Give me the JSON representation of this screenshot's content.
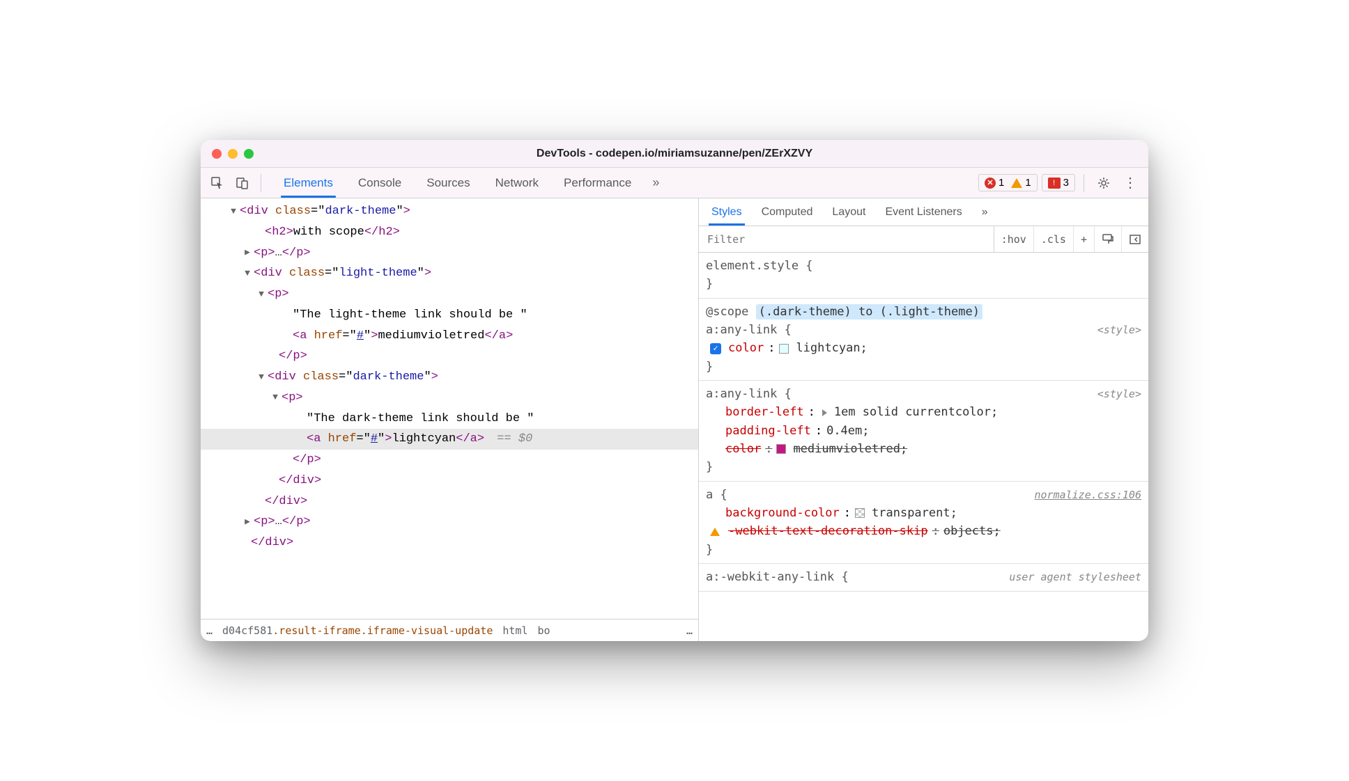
{
  "window": {
    "title": "DevTools - codepen.io/miriamsuzanne/pen/ZErXZVY"
  },
  "toolbar": {
    "tabs": [
      "Elements",
      "Console",
      "Sources",
      "Network",
      "Performance"
    ],
    "active_tab": 0,
    "errors": "1",
    "warnings": "1",
    "issues": "3"
  },
  "dom": {
    "lines": [
      {
        "indent": 40,
        "arrow": "▼",
        "html": "<span class='tag'>&lt;div</span> <span class='attr-name'>class</span>=\"<span class='attr-value'>dark-theme</span>\"<span class='tag'>&gt;</span>"
      },
      {
        "indent": 76,
        "arrow": "",
        "html": "<span class='tag'>&lt;h2&gt;</span><span class='text-content'>with scope</span><span class='tag'>&lt;/h2&gt;</span>"
      },
      {
        "indent": 60,
        "arrow": "▶",
        "html": "<span class='tag'>&lt;p&gt;</span><span class='ellipsis'>…</span><span class='tag'>&lt;/p&gt;</span>"
      },
      {
        "indent": 60,
        "arrow": "▼",
        "html": "<span class='tag'>&lt;div</span> <span class='attr-name'>class</span>=\"<span class='attr-value'>light-theme</span>\"<span class='tag'>&gt;</span>"
      },
      {
        "indent": 80,
        "arrow": "▼",
        "html": "<span class='tag'>&lt;p&gt;</span>"
      },
      {
        "indent": 116,
        "arrow": "",
        "html": "<span class='text-content'>\"The light-theme link should be \"</span>"
      },
      {
        "indent": 116,
        "arrow": "",
        "html": "<span class='tag'>&lt;a</span> <span class='attr-name'>href</span>=\"<span class='href-link'>#</span>\"<span class='tag'>&gt;</span><span class='text-content'>mediumvioletred</span><span class='tag'>&lt;/a&gt;</span>"
      },
      {
        "indent": 96,
        "arrow": "",
        "html": "<span class='tag'>&lt;/p&gt;</span>"
      },
      {
        "indent": 80,
        "arrow": "▼",
        "html": "<span class='tag'>&lt;div</span> <span class='attr-name'>class</span>=\"<span class='attr-value'>dark-theme</span>\"<span class='tag'>&gt;</span>"
      },
      {
        "indent": 100,
        "arrow": "▼",
        "html": "<span class='tag'>&lt;p&gt;</span>"
      },
      {
        "indent": 136,
        "arrow": "",
        "html": "<span class='text-content'>\"The dark-theme link should be \"</span>"
      },
      {
        "indent": 136,
        "arrow": "",
        "selected": true,
        "html": "<span class='tag'>&lt;a</span> <span class='attr-name'>href</span>=\"<span class='href-link'>#</span>\"<span class='tag'>&gt;</span><span class='text-content'>lightcyan</span><span class='tag'>&lt;/a&gt;</span><span class='selector-dollar'> == $0</span>"
      },
      {
        "indent": 116,
        "arrow": "",
        "html": "<span class='tag'>&lt;/p&gt;</span>"
      },
      {
        "indent": 96,
        "arrow": "",
        "html": "<span class='tag'>&lt;/div&gt;</span>"
      },
      {
        "indent": 76,
        "arrow": "",
        "html": "<span class='tag'>&lt;/div&gt;</span>"
      },
      {
        "indent": 60,
        "arrow": "▶",
        "html": "<span class='tag'>&lt;p&gt;</span><span class='ellipsis'>…</span><span class='tag'>&lt;/p&gt;</span>"
      },
      {
        "indent": 56,
        "arrow": "",
        "html": "<span class='tag'>&lt;/div&gt;</span>"
      }
    ]
  },
  "breadcrumb": {
    "prefix": "…",
    "items": [
      {
        "text": "d04cf581",
        "cls": ""
      },
      {
        "text": ".result-iframe.iframe-visual-update",
        "cls": "highlight",
        "inline": true
      },
      {
        "text": "html",
        "cls": ""
      },
      {
        "text": "bo",
        "cls": ""
      }
    ],
    "suffix": "…"
  },
  "styles": {
    "tabs": [
      "Styles",
      "Computed",
      "Layout",
      "Event Listeners"
    ],
    "active_tab": 0,
    "filter_placeholder": "Filter",
    "tools": [
      ":hov",
      ".cls",
      "+"
    ],
    "rules": [
      {
        "selector": "element.style {",
        "source": "",
        "decls": [],
        "close": "}"
      },
      {
        "scope_prefix": "@scope",
        "scope_highlight": "(.dark-theme) to (.light-theme)",
        "selector": "a:any-link {",
        "source": "<style>",
        "decls": [
          {
            "checkbox": true,
            "name": "color",
            "value": "lightcyan",
            "swatch": "#e0ffff"
          }
        ],
        "close": "}"
      },
      {
        "selector": "a:any-link {",
        "source": "<style>",
        "decls": [
          {
            "name": "border-left",
            "value": "1em solid currentcolor",
            "expand": true
          },
          {
            "name": "padding-left",
            "value": "0.4em"
          },
          {
            "name": "color",
            "value": "mediumvioletred",
            "swatch": "#c71585",
            "strike": true
          }
        ],
        "close": "}"
      },
      {
        "selector": "a {",
        "source": "normalize.css:106",
        "source_link": true,
        "decls": [
          {
            "name": "background-color",
            "value": "transparent",
            "swatch": "transparent"
          },
          {
            "name": "-webkit-text-decoration-skip",
            "value": "objects",
            "strike": true,
            "warn": true
          }
        ],
        "close": "}"
      },
      {
        "selector": "a:-webkit-any-link {",
        "source": "user agent stylesheet",
        "source_nolink": true,
        "decls": [],
        "close": ""
      }
    ]
  }
}
